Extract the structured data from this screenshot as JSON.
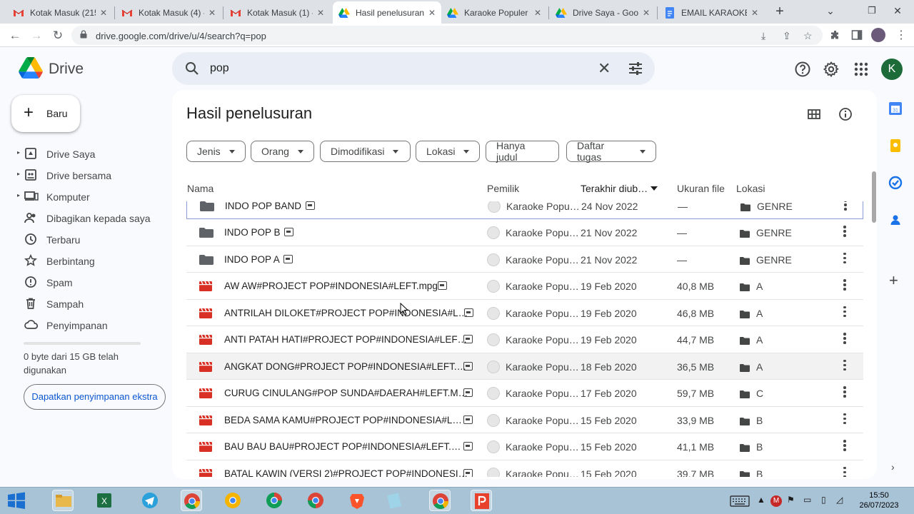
{
  "browser": {
    "tabs": [
      {
        "title": "Kotak Masuk (215",
        "icon": "gmail-icon"
      },
      {
        "title": "Kotak Masuk (4) -",
        "icon": "gmail-icon"
      },
      {
        "title": "Kotak Masuk (1) -",
        "icon": "gmail-icon"
      },
      {
        "title": "Hasil penelusuran",
        "icon": "drive-icon"
      },
      {
        "title": "Karaoke Populer -",
        "icon": "drive-icon"
      },
      {
        "title": "Drive Saya - Goog",
        "icon": "drive-icon"
      },
      {
        "title": "EMAIL KARAOKE -",
        "icon": "docs-icon"
      }
    ],
    "url": "drive.google.com/drive/u/4/search?q=pop"
  },
  "header": {
    "app_name": "Drive",
    "search_value": "pop",
    "avatar_letter": "K"
  },
  "sidebar": {
    "new_button": "Baru",
    "items": [
      {
        "label": "Drive Saya",
        "icon": "my-drive-icon",
        "expandable": true
      },
      {
        "label": "Drive bersama",
        "icon": "shared-drives-icon",
        "expandable": true
      },
      {
        "label": "Komputer",
        "icon": "computer-icon",
        "expandable": true
      },
      {
        "label": "Dibagikan kepada saya",
        "icon": "shared-with-me-icon",
        "expandable": false
      },
      {
        "label": "Terbaru",
        "icon": "clock-icon",
        "expandable": false
      },
      {
        "label": "Berbintang",
        "icon": "star-icon",
        "expandable": false
      },
      {
        "label": "Spam",
        "icon": "spam-icon",
        "expandable": false
      },
      {
        "label": "Sampah",
        "icon": "trash-icon",
        "expandable": false
      },
      {
        "label": "Penyimpanan",
        "icon": "cloud-icon",
        "expandable": false
      }
    ],
    "storage_text": "0 byte dari 15 GB telah digunakan",
    "storage_button": "Dapatkan penyimpanan ekstra"
  },
  "main": {
    "title": "Hasil penelusuran",
    "filters": [
      "Jenis",
      "Orang",
      "Dimodifikasi",
      "Lokasi",
      "Hanya judul",
      "Daftar tugas"
    ],
    "columns": {
      "name": "Nama",
      "owner": "Pemilik",
      "modified": "Terakhir diub…",
      "size": "Ukuran file",
      "location": "Lokasi"
    },
    "rows": [
      {
        "name": "INDO POP BAND",
        "type": "folder",
        "owner": "Karaoke Popu…",
        "modified": "24 Nov 2022",
        "size": "—",
        "location": "GENRE"
      },
      {
        "name": "INDO POP B",
        "type": "folder",
        "owner": "Karaoke Popu…",
        "modified": "21 Nov 2022",
        "size": "—",
        "location": "GENRE"
      },
      {
        "name": "INDO POP A",
        "type": "folder",
        "owner": "Karaoke Popu…",
        "modified": "21 Nov 2022",
        "size": "—",
        "location": "GENRE"
      },
      {
        "name": "AW AW#PROJECT POP#INDONESIA#LEFT.mpg",
        "type": "video",
        "owner": "Karaoke Popu…",
        "modified": "19 Feb 2020",
        "size": "40,8 MB",
        "location": "A"
      },
      {
        "name": "ANTRILAH DILOKET#PROJECT POP#INDONESIA#L…",
        "type": "video",
        "owner": "Karaoke Popu…",
        "modified": "19 Feb 2020",
        "size": "46,8 MB",
        "location": "A"
      },
      {
        "name": "ANTI PATAH HATI#PROJECT POP#INDONESIA#LEF…",
        "type": "video",
        "owner": "Karaoke Popu…",
        "modified": "19 Feb 2020",
        "size": "44,7 MB",
        "location": "A"
      },
      {
        "name": "ANGKAT DONG#PROJECT POP#INDONESIA#LEFT.…",
        "type": "video",
        "owner": "Karaoke Popu…",
        "modified": "18 Feb 2020",
        "size": "36,5 MB",
        "location": "A"
      },
      {
        "name": "CURUG CINULANG#POP SUNDA#DAERAH#LEFT.M…",
        "type": "video",
        "owner": "Karaoke Popu…",
        "modified": "17 Feb 2020",
        "size": "59,7 MB",
        "location": "C"
      },
      {
        "name": "BEDA SAMA KAMU#PROJECT POP#INDONESIA#L…",
        "type": "video",
        "owner": "Karaoke Popu…",
        "modified": "15 Feb 2020",
        "size": "33,9 MB",
        "location": "B"
      },
      {
        "name": "BAU BAU BAU#PROJECT POP#INDONESIA#LEFT.…",
        "type": "video",
        "owner": "Karaoke Popu…",
        "modified": "15 Feb 2020",
        "size": "41,1 MB",
        "location": "B"
      },
      {
        "name": "BATAL KAWIN (VERSI 2)#PROJECT POP#INDONESI…",
        "type": "video",
        "owner": "Karaoke Popu…",
        "modified": "15 Feb 2020",
        "size": "39,7 MB",
        "location": "B"
      }
    ]
  },
  "taskbar": {
    "time": "15:50",
    "date": "26/07/2023"
  },
  "colors": {
    "accent": "#0b57d0",
    "search_bg": "#e9eef6",
    "video_icon": "#d93025",
    "folder_icon": "#5f6368"
  }
}
